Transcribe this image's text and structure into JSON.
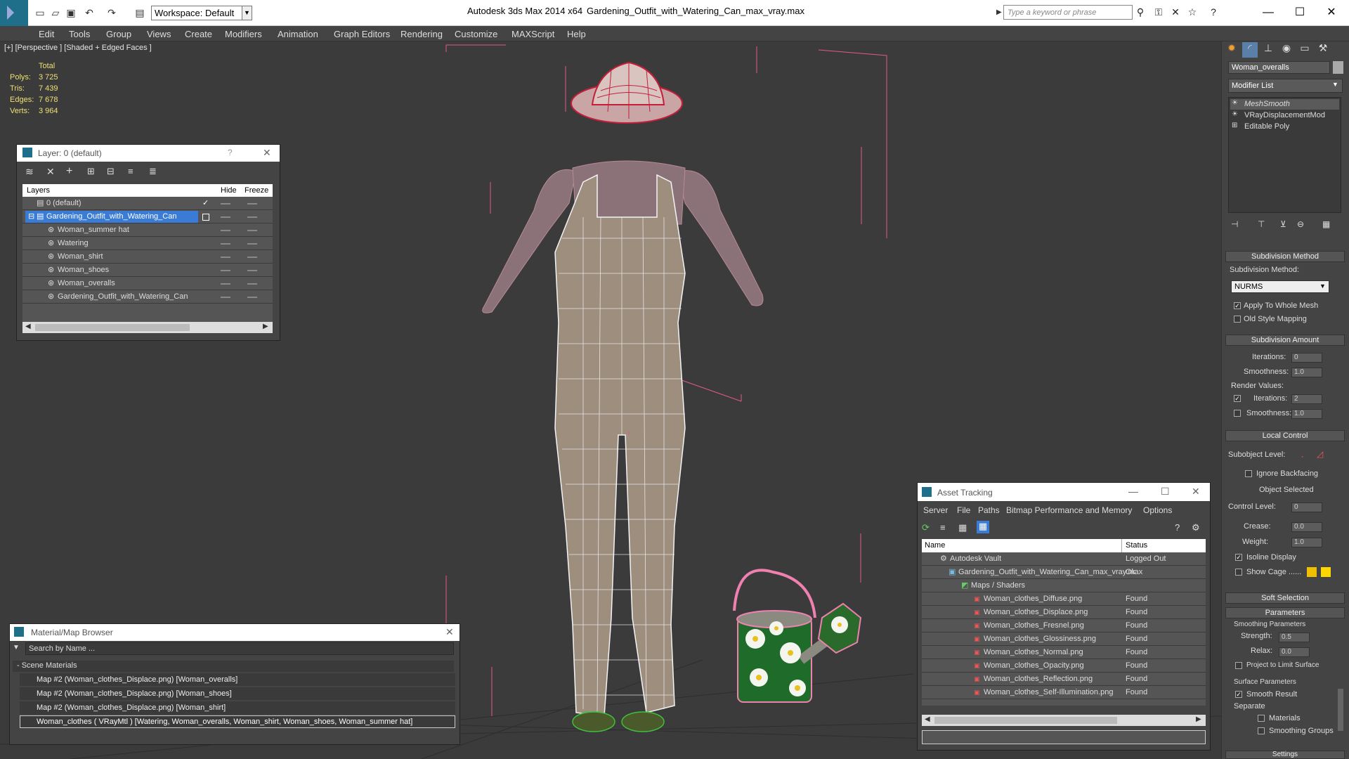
{
  "titlebar": {
    "app_title": "Autodesk 3ds Max  2014 x64",
    "file_title": "Gardening_Outfit_with_Watering_Can_max_vray.max",
    "workspace_value": "Workspace: Default",
    "search_placeholder": "Type a keyword or phrase"
  },
  "menu": [
    "Edit",
    "Tools",
    "Group",
    "Views",
    "Create",
    "Modifiers",
    "Animation",
    "Graph Editors",
    "Rendering",
    "Customize",
    "MAXScript",
    "Help"
  ],
  "viewport": {
    "label": "[+] [Perspective ] [Shaded + Edged Faces ]",
    "stats": {
      "header": "Total",
      "rows": [
        {
          "label": "Polys:",
          "value": "3 725"
        },
        {
          "label": "Tris:",
          "value": "7 439"
        },
        {
          "label": "Edges:",
          "value": "7 678"
        },
        {
          "label": "Verts:",
          "value": "3 964"
        }
      ]
    }
  },
  "layer_window": {
    "title": "Layer: 0 (default)",
    "help": "?",
    "columns": {
      "layers": "Layers",
      "hide": "Hide",
      "freeze": "Freeze"
    },
    "rows": [
      {
        "name": "0 (default)",
        "level": 0
      },
      {
        "name": "Gardening_Outfit_with_Watering_Can",
        "level": 0
      },
      {
        "name": "Woman_summer hat",
        "level": 1
      },
      {
        "name": "Watering",
        "level": 1
      },
      {
        "name": "Woman_shirt",
        "level": 1
      },
      {
        "name": "Woman_shoes",
        "level": 1
      },
      {
        "name": "Woman_overalls",
        "level": 1
      },
      {
        "name": "Gardening_Outfit_with_Watering_Can",
        "level": 1
      }
    ]
  },
  "material_browser": {
    "title": "Material/Map Browser",
    "search_placeholder": "Search by Name ...",
    "section": "- Scene Materials",
    "items": [
      "Map #2 (Woman_clothes_Displace.png) [Woman_overalls]",
      "Map #2 (Woman_clothes_Displace.png) [Woman_shoes]",
      "Map #2 (Woman_clothes_Displace.png) [Woman_shirt]",
      "Woman_clothes  ( VRayMtl ) [Watering, Woman_overalls, Woman_shirt, Woman_shoes, Woman_summer hat]"
    ]
  },
  "asset_tracking": {
    "title": "Asset Tracking",
    "menu": [
      "Server",
      "File",
      "Paths",
      "Bitmap Performance and Memory",
      "Options"
    ],
    "columns": {
      "name": "Name",
      "status": "Status"
    },
    "rows": [
      {
        "name": "Autodesk Vault",
        "status": "Logged Out",
        "indent": 1
      },
      {
        "name": "Gardening_Outfit_with_Watering_Can_max_vray.max",
        "status": "Ok",
        "indent": 2
      },
      {
        "name": "Maps / Shaders",
        "status": "",
        "indent": 3
      },
      {
        "name": "Woman_clothes_Diffuse.png",
        "status": "Found",
        "indent": 4
      },
      {
        "name": "Woman_clothes_Displace.png",
        "status": "Found",
        "indent": 4
      },
      {
        "name": "Woman_clothes_Fresnel.png",
        "status": "Found",
        "indent": 4
      },
      {
        "name": "Woman_clothes_Glossiness.png",
        "status": "Found",
        "indent": 4
      },
      {
        "name": "Woman_clothes_Normal.png",
        "status": "Found",
        "indent": 4
      },
      {
        "name": "Woman_clothes_Opacity.png",
        "status": "Found",
        "indent": 4
      },
      {
        "name": "Woman_clothes_Reflection.png",
        "status": "Found",
        "indent": 4
      },
      {
        "name": "Woman_clothes_Self-Illumination.png",
        "status": "Found",
        "indent": 4
      }
    ]
  },
  "command_panel": {
    "object_name": "Woman_overalls",
    "modifier_list": "Modifier List",
    "stack": [
      "MeshSmooth",
      "VRayDisplacementMod",
      "Editable Poly"
    ],
    "subdivision_method": {
      "header": "Subdivision Method",
      "label": "Subdivision Method:",
      "value": "NURMS",
      "apply_whole_mesh": "Apply To Whole Mesh",
      "old_style": "Old Style Mapping"
    },
    "subdivision_amount": {
      "header": "Subdivision Amount",
      "iterations_label": "Iterations:",
      "iterations": "0",
      "smoothness_label": "Smoothness:",
      "smoothness": "1.0",
      "render_values": "Render Values:",
      "r_iterations_label": "Iterations:",
      "r_iterations": "2",
      "r_smoothness_label": "Smoothness:",
      "r_smoothness": "1.0"
    },
    "local_control": {
      "header": "Local Control",
      "subobject": "Subobject Level:",
      "ignore_backfacing": "Ignore Backfacing",
      "object_selected": "Object Selected",
      "control_level_label": "Control Level:",
      "control_level": "0",
      "crease_label": "Crease:",
      "crease": "0.0",
      "weight_label": "Weight:",
      "weight": "1.0",
      "isoline": "Isoline Display",
      "show_cage": "Show Cage ......"
    },
    "soft_selection": {
      "header": "Soft Selection"
    },
    "parameters": {
      "header": "Parameters",
      "smoothing": "Smoothing Parameters",
      "strength_label": "Strength:",
      "strength": "0.5",
      "relax_label": "Relax:",
      "relax": "0.0",
      "project": "Project to Limit Surface",
      "surface": "Surface Parameters",
      "smooth_result": "Smooth Result",
      "separate": "Separate",
      "materials": "Materials",
      "smoothing_groups": "Smoothing Groups"
    },
    "settings": "Settings"
  },
  "colors": {
    "accent": "#3a7bd5",
    "cage1": "#f0c000",
    "cage2": "#ffd700",
    "bbox": "#e05a8a"
  }
}
